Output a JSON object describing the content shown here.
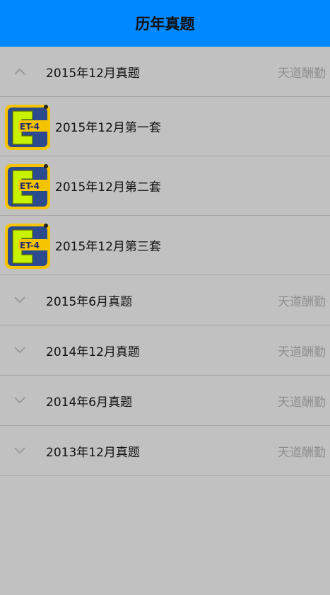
{
  "header": {
    "title": "历年真题"
  },
  "groups": [
    {
      "title": "2015年12月真题",
      "subtitle": "天道酬勤",
      "expanded": true,
      "items": [
        {
          "title": "2015年12月第一套",
          "icon": "cet4-app-icon"
        },
        {
          "title": "2015年12月第二套",
          "icon": "cet4-app-icon"
        },
        {
          "title": "2015年12月第三套",
          "icon": "cet4-app-icon"
        }
      ]
    },
    {
      "title": "2015年6月真题",
      "subtitle": "天道酬勤",
      "expanded": false
    },
    {
      "title": "2014年12月真题",
      "subtitle": "天道酬勤",
      "expanded": false
    },
    {
      "title": "2014年6月真题",
      "subtitle": "天道酬勤",
      "expanded": false
    },
    {
      "title": "2013年12月真题",
      "subtitle": "天道酬勤",
      "expanded": false
    }
  ],
  "icon_text": "ET-4",
  "colors": {
    "header": "#0088ff",
    "background": "#c1c1c1",
    "subtitle": "#8f8f8f"
  }
}
